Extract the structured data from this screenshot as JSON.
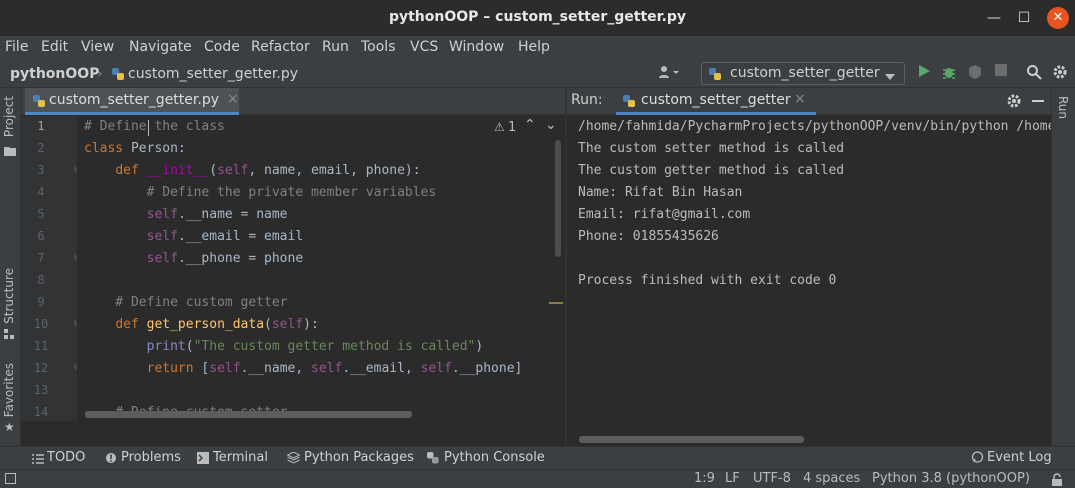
{
  "window": {
    "title": "pythonOOP – custom_setter_getter.py",
    "minimize_glyph": "—",
    "maximize_glyph": "☐",
    "close_glyph": "✕"
  },
  "menu": [
    "File",
    "Edit",
    "View",
    "Navigate",
    "Code",
    "Refactor",
    "Run",
    "Tools",
    "VCS",
    "Window",
    "Help"
  ],
  "breadcrumb": {
    "project": "pythonOOP",
    "file": "custom_setter_getter.py"
  },
  "run_config": {
    "name": "custom_setter_getter",
    "icons": [
      "python-icon",
      "chevron-down-icon"
    ]
  },
  "toolbar_icons": [
    "user-menu-icon",
    "run-icon",
    "debug-icon",
    "coverage-icon",
    "stop-icon",
    "search-icon",
    "settings-icon"
  ],
  "left_stripe": [
    "Project",
    "Structure",
    "Favorites"
  ],
  "right_stripe": [
    "Run"
  ],
  "editor": {
    "tab_label": "custom_setter_getter.py",
    "tab_close": "×",
    "warnings": "1",
    "line_numbers": [
      "1",
      "2",
      "3",
      "4",
      "5",
      "6",
      "7",
      "8",
      "9",
      "10",
      "11",
      "12",
      "13",
      "14"
    ],
    "current_line": "1"
  },
  "run_panel": {
    "label": "Run:",
    "tab_label": "custom_setter_getter",
    "tab_close": "×",
    "output": [
      "/home/fahmida/PycharmProjects/pythonOOP/venv/bin/python /home/",
      "The custom setter method is called",
      "The custom getter method is called",
      "Name: Rifat Bin Hasan",
      "Email: rifat@gmail.com",
      "Phone: 01855435626",
      "",
      "Process finished with exit code 0"
    ]
  },
  "tool_windows": [
    "TODO",
    "Problems",
    "Terminal",
    "Python Packages",
    "Python Console"
  ],
  "event_log": "Event Log",
  "status": {
    "position": "1:9",
    "line_sep": "LF",
    "encoding": "UTF-8",
    "indent": "4 spaces",
    "interpreter": "Python 3.8 (pythonOOP)"
  },
  "colors": {
    "accent": "#4a88c7",
    "close_button": "#e95420",
    "run_green": "#59a869",
    "keyword": "#cc7832",
    "comment": "#808080",
    "function": "#ffc66d",
    "string": "#6a8759"
  }
}
